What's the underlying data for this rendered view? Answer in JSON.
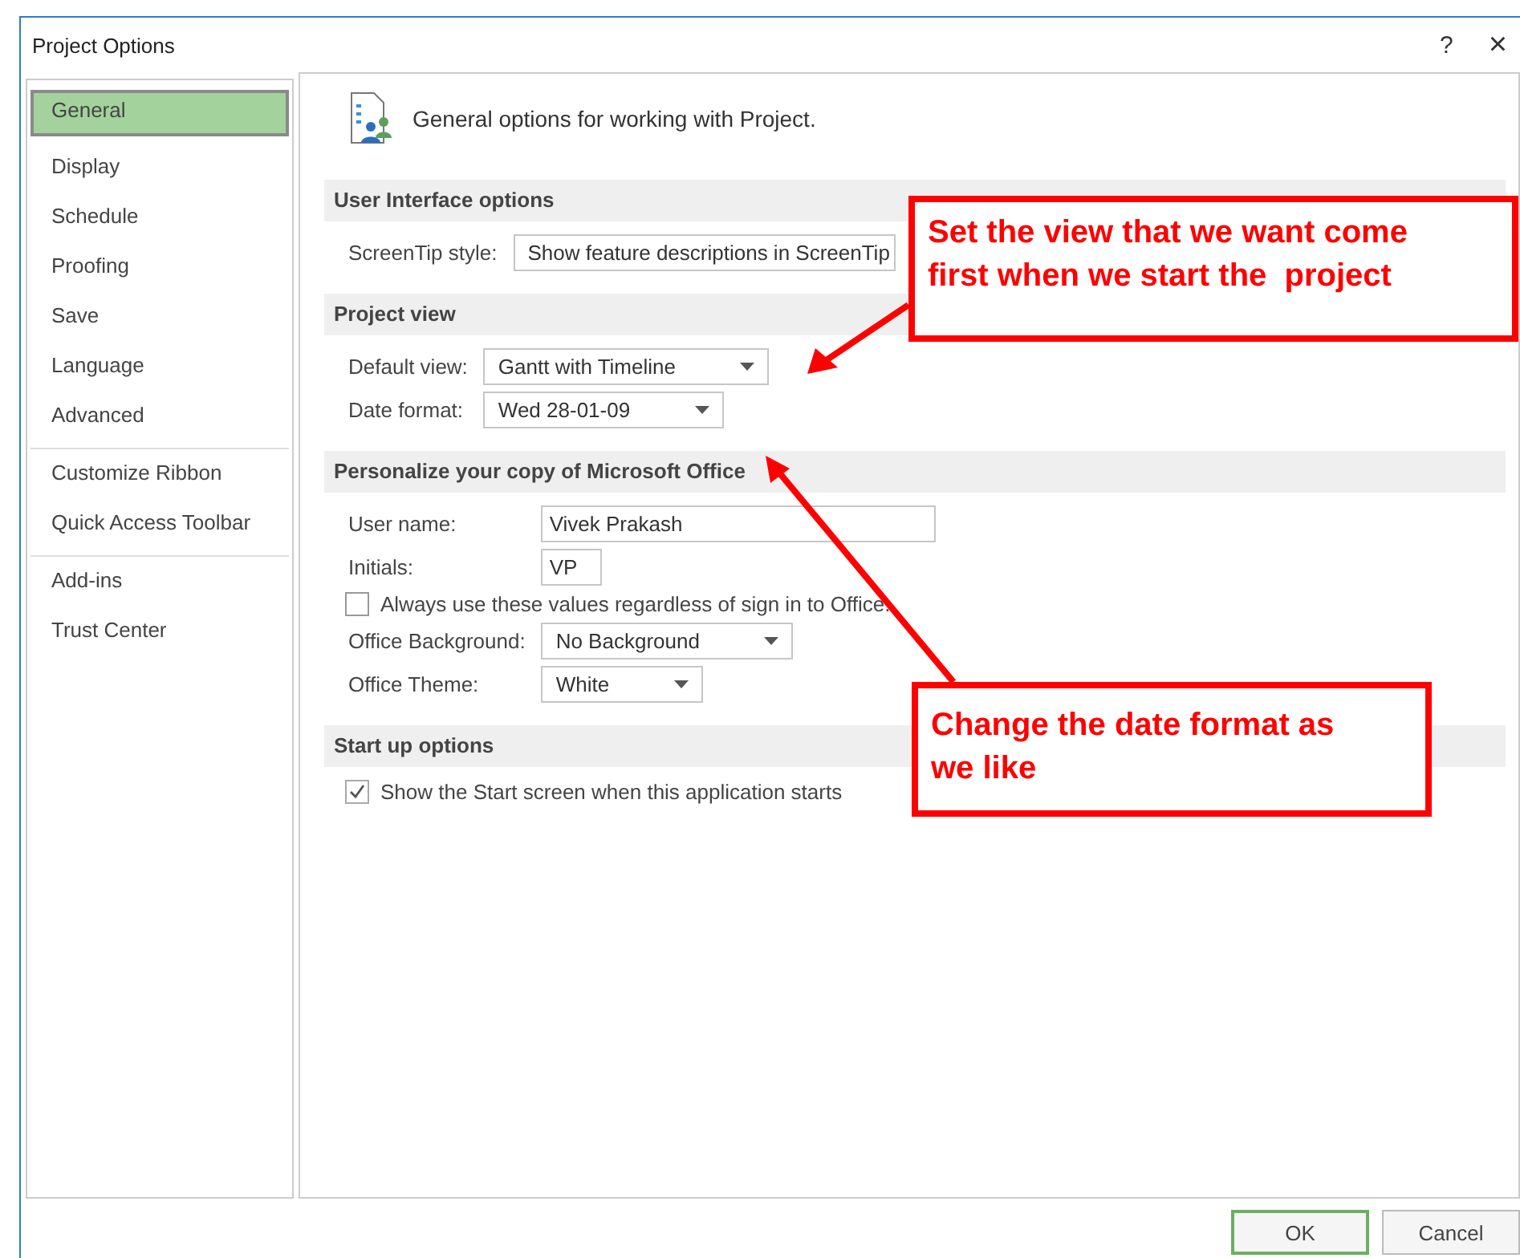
{
  "window": {
    "title": "Project Options",
    "help": "?",
    "close": "×"
  },
  "sidebar": {
    "groups": [
      {
        "items": [
          {
            "label": "General",
            "selected": true
          },
          {
            "label": "Display",
            "selected": false
          },
          {
            "label": "Schedule",
            "selected": false
          },
          {
            "label": "Proofing",
            "selected": false
          },
          {
            "label": "Save",
            "selected": false
          },
          {
            "label": "Language",
            "selected": false
          },
          {
            "label": "Advanced",
            "selected": false
          }
        ]
      },
      {
        "items": [
          {
            "label": "Customize Ribbon",
            "selected": false
          },
          {
            "label": "Quick Access Toolbar",
            "selected": false
          }
        ]
      },
      {
        "items": [
          {
            "label": "Add-ins",
            "selected": false
          },
          {
            "label": "Trust Center",
            "selected": false
          }
        ]
      }
    ]
  },
  "header": "General options for working with Project.",
  "sections": [
    {
      "title": "User Interface options",
      "rows": [
        {
          "kind": "select",
          "label": "ScreenTip style:",
          "value": "Show feature descriptions in ScreenTip",
          "covered": true
        }
      ]
    },
    {
      "title": "Project view",
      "rows": [
        {
          "kind": "select",
          "label": "Default view:",
          "value": "Gantt with Timeline"
        },
        {
          "kind": "select",
          "label": "Date format:",
          "value": "Wed 28-01-09"
        }
      ]
    },
    {
      "title": "Personalize your copy of Microsoft Office",
      "rows": [
        {
          "kind": "text",
          "label": "User name:",
          "value": "Vivek Prakash"
        },
        {
          "kind": "short-text",
          "label": "Initials:",
          "value": "VP"
        },
        {
          "kind": "checkbox",
          "label": "Always use these values regardless of sign in to Office.",
          "checked": false
        },
        {
          "kind": "select",
          "label": "Office Background:",
          "value": "No Background"
        },
        {
          "kind": "select",
          "label": "Office Theme:",
          "value": "White"
        }
      ]
    },
    {
      "title": "Start up options",
      "rows": [
        {
          "kind": "checkbox",
          "label": "Show the Start screen when this application starts",
          "checked": true
        }
      ]
    }
  ],
  "buttons": [
    {
      "label": "OK",
      "default": true
    },
    {
      "label": "Cancel",
      "default": false
    }
  ],
  "annotations": [
    {
      "lines": [
        "Set the view that we want come",
        "first when we start the  project"
      ]
    },
    {
      "lines": [
        "Change the date format as",
        "we like"
      ]
    }
  ]
}
